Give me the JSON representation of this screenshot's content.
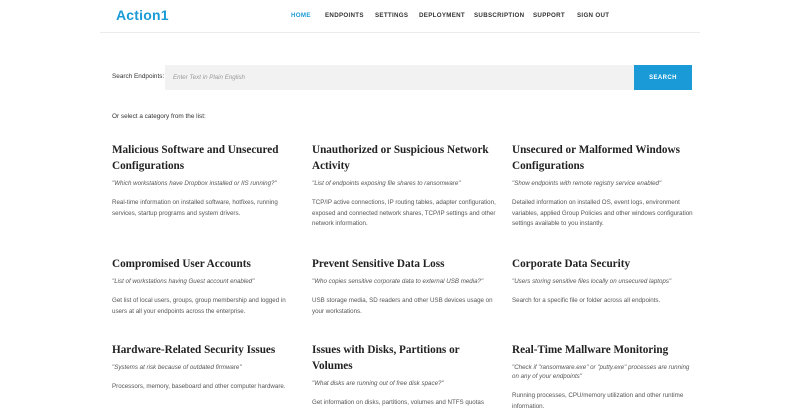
{
  "header": {
    "logo": "Action1",
    "nav": [
      {
        "label": "HOME",
        "active": true
      },
      {
        "label": "ENDPOINTS",
        "active": false
      },
      {
        "label": "SETTINGS",
        "active": false
      },
      {
        "label": "DEPLOYMENT",
        "active": false
      },
      {
        "label": "SUBSCRIPTION",
        "active": false
      },
      {
        "label": "SUPPORT",
        "active": false
      },
      {
        "label": "SIGN OUT",
        "active": false
      }
    ]
  },
  "search": {
    "label": "Search Endpoints:",
    "placeholder": "Enter Text in Plain English",
    "button": "SEARCH"
  },
  "select_hint": "Or select a category from the list:",
  "categories": [
    {
      "title": "Malicious Software and Unsecured Configurations",
      "example": "\"Which workstations have Dropbox installed or IIS running?\"",
      "description": "Real-time information on installed software, hotfixes, running services, startup programs and system drivers."
    },
    {
      "title": "Unauthorized or Suspicious Network Activity",
      "example": "\"List of endpoints exposing file shares to ransomware\"",
      "description": "TCP/IP active connections, IP routing tables, adapter configuration, exposed and connected network shares, TCP/IP settings and other network information."
    },
    {
      "title": "Unsecured or Malformed Windows Configurations",
      "example": "\"Show endpoints with remote registry service enabled\"",
      "description": "Detailed information on installed OS, event logs, environment variables, applied Group Policies and other windows configuration settings available to you instantly."
    },
    {
      "title": "Compromised User Accounts",
      "example": "\"List of workstations having Guest account enabled\"",
      "description": "Get list of local users, groups, group membership and logged in users at all your endpoints across the enterprise."
    },
    {
      "title": "Prevent Sensitive Data Loss",
      "example": "\"Who copies sensitive corporate data to external USB media?\"",
      "description": "USB storage media, SD readers and other USB devices usage on your workstations."
    },
    {
      "title": "Corporate Data Security",
      "example": "\"Users storing sensitive files locally on unsecured laptops\"",
      "description": "Search for a specific file or folder across all endpoints."
    },
    {
      "title": "Hardware-Related Security Issues",
      "example": "\"Systems at risk because of outdated firmware\"",
      "description": "Processors, memory, baseboard and other computer hardware."
    },
    {
      "title": "Issues with Disks, Partitions or Volumes",
      "example": "\"What disks are running out of free disk space?\"",
      "description": "Get information on disks, partitions, volumes and NTFS quotas"
    },
    {
      "title": "Real-Time Mallware Monitoring",
      "example": "\"Check if \"ransomware.exe\" or \"putty.exe\" processes are running on any of your endpoints\"",
      "description": "Running processes, CPU/memory utilization and other runtime information."
    }
  ],
  "colors": {
    "accent": "#1a9bd7",
    "text": "#333333",
    "search_bg": "#f2f2f2"
  }
}
